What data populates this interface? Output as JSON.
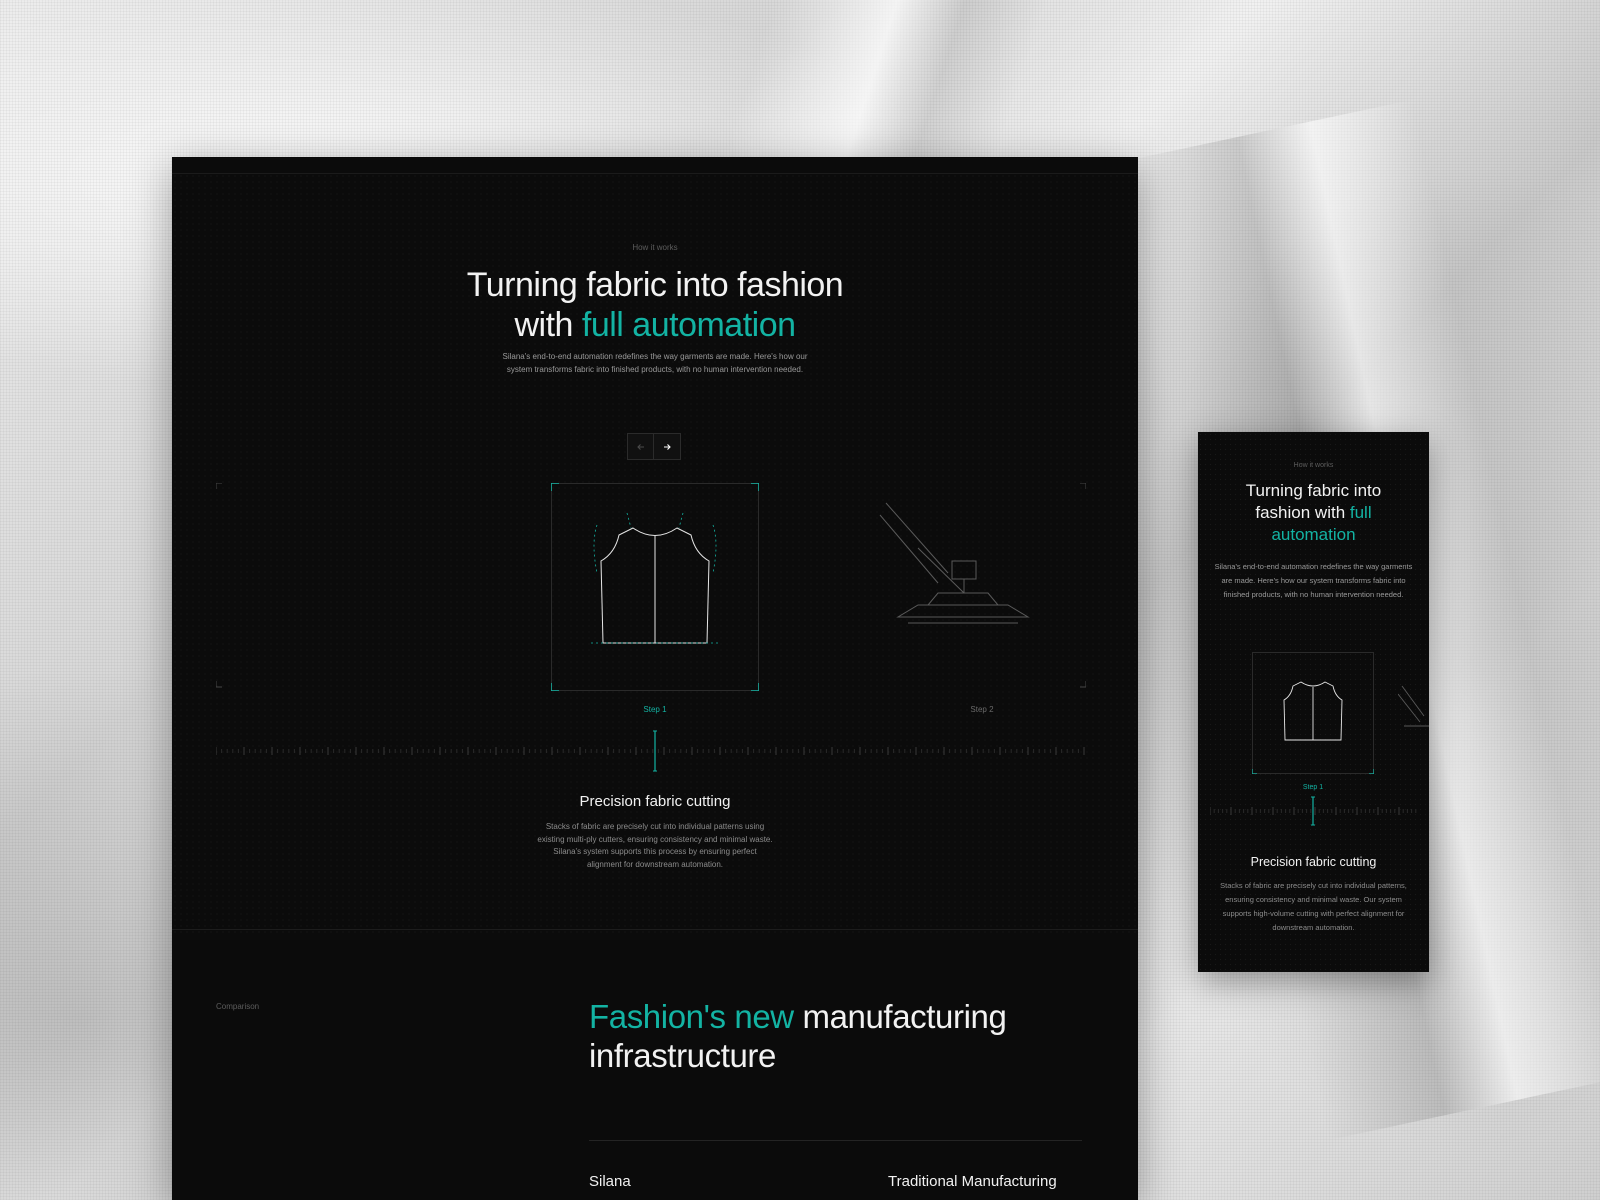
{
  "colors": {
    "accent": "#13b3a3",
    "panel_bg": "#0b0b0b",
    "text_primary": "#f2f2f2",
    "text_muted": "#8c8c8c"
  },
  "desktop": {
    "how_it_works": {
      "eyebrow": "How it works",
      "title_line1": "Turning fabric into fashion",
      "title_line2_prefix": "with ",
      "title_line2_accent": "full automation",
      "description": "Silana's end-to-end automation redefines the way garments are made. Here's how our system transforms fabric into finished products, with no human intervention needed.",
      "prev_icon": "arrow-left-icon",
      "next_icon": "arrow-right-icon",
      "steps": [
        {
          "label": "Step 1",
          "active": true,
          "illustration": "garment-pattern-icon"
        },
        {
          "label": "Step 2",
          "active": false,
          "illustration": "robotic-arm-icon"
        }
      ],
      "active_step_title": "Precision fabric cutting",
      "active_step_description": "Stacks of fabric are precisely cut into individual patterns using existing multi-ply cutters, ensuring consistency and minimal waste. Silana's system supports this process by ensuring perfect alignment for downstream automation."
    },
    "comparison": {
      "eyebrow": "Comparison",
      "title_accent": "Fashion's new",
      "title_rest_line1": " manufacturing",
      "title_line2": "infrastructure",
      "columns": [
        "Silana",
        "Traditional Manufacturing"
      ]
    }
  },
  "mobile": {
    "eyebrow": "How it works",
    "title_part1": "Turning fabric into fashion with ",
    "title_accent": "full automation",
    "description": "Silana's end-to-end automation redefines the way garments are made. Here's how our system transforms fabric into finished products, with no human intervention needed.",
    "step_label": "Step 1",
    "step_title": "Precision fabric cutting",
    "step_description": "Stacks of fabric are precisely cut into individual patterns, ensuring consistency and minimal waste. Our system supports high-volume cutting with perfect alignment for downstream automation."
  }
}
